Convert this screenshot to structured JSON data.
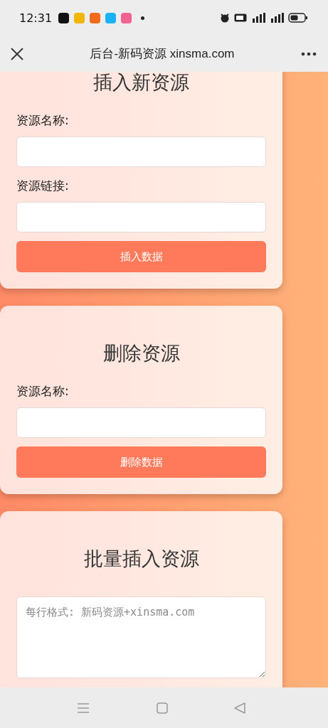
{
  "status_bar": {
    "time": "12:31",
    "app_icons": [
      {
        "color": "#111111"
      },
      {
        "color": "#f2b705"
      },
      {
        "color": "#f26a1b"
      },
      {
        "color": "#1ab2f5"
      },
      {
        "color": "#f06292"
      }
    ]
  },
  "nav_bar": {
    "title": "后台-新码资源 xinsma.com"
  },
  "sections": [
    {
      "title": "插入新资源",
      "fields": [
        {
          "kind": "input",
          "label": "资源名称:"
        },
        {
          "kind": "input",
          "label": "资源链接:"
        }
      ],
      "button": {
        "kind": "submit",
        "label": "插入数据"
      }
    },
    {
      "title": "删除资源",
      "fields": [
        {
          "kind": "input",
          "label": "资源名称:"
        }
      ],
      "button": {
        "kind": "submit",
        "label": "删除数据"
      }
    },
    {
      "title": "批量插入资源",
      "fields": [
        {
          "kind": "textarea",
          "placeholder": "每行格式: 新码资源+xinsma.com"
        }
      ]
    }
  ]
}
